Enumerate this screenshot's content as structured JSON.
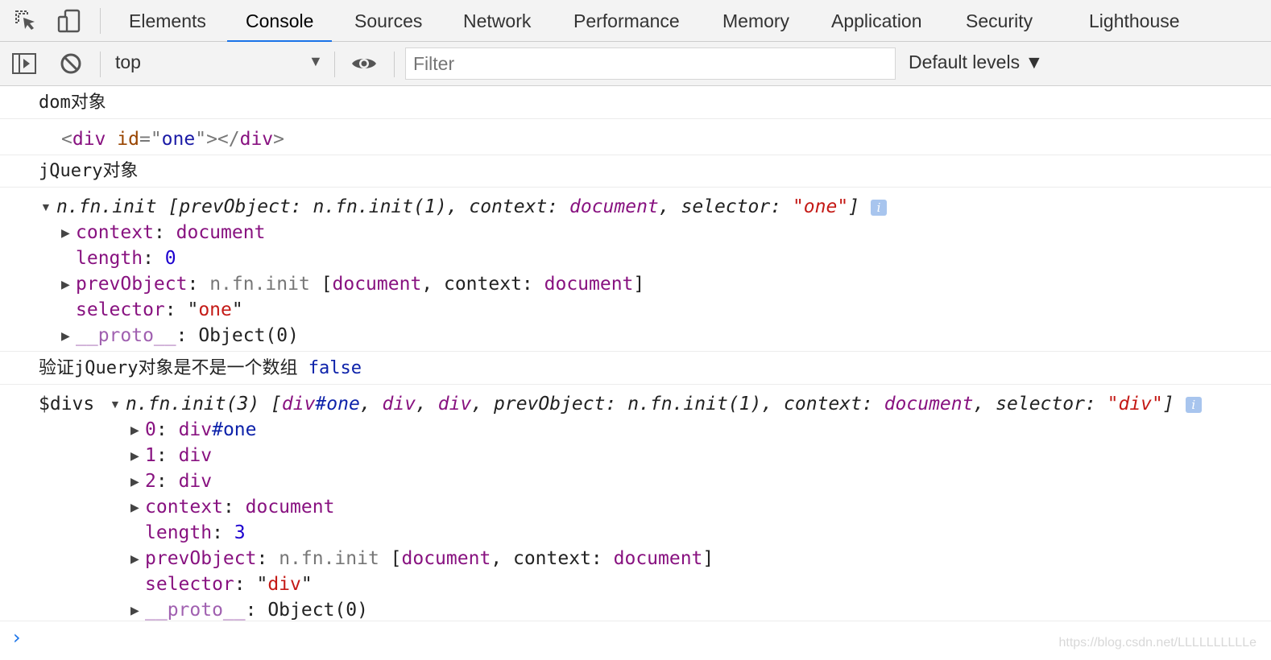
{
  "tabs": [
    "Elements",
    "Console",
    "Sources",
    "Network",
    "Performance",
    "Memory",
    "Application",
    "Security",
    "Lighthouse"
  ],
  "active_tab": "Console",
  "toolbar": {
    "context": "top",
    "filter_placeholder": "Filter",
    "levels": "Default levels ▼"
  },
  "messages": {
    "m1": "dom对象",
    "m2": "jQuery对象",
    "m3": "验证jQuery对象是不是一个数组",
    "m3_value": "false",
    "m4_label": "$divs"
  },
  "dom_element": {
    "tag": "div",
    "attr": "id",
    "value": "one"
  },
  "jq1": {
    "summary_head": "n.fn.init",
    "context_value": "document",
    "length": "0",
    "selector": "\"one\"",
    "prev_object": "n.fn.init",
    "proto_value": "Object(0)"
  },
  "jq2": {
    "summary_head": "n.fn.init(3)",
    "items": [
      "div#one",
      "div",
      "div"
    ],
    "context_value": "document",
    "length": "3",
    "selector": "\"div\"",
    "prev_object": "n.fn.init",
    "proto_value": "Object(0)"
  },
  "watermark": "https://blog.csdn.net/LLLLLLLLLLe"
}
